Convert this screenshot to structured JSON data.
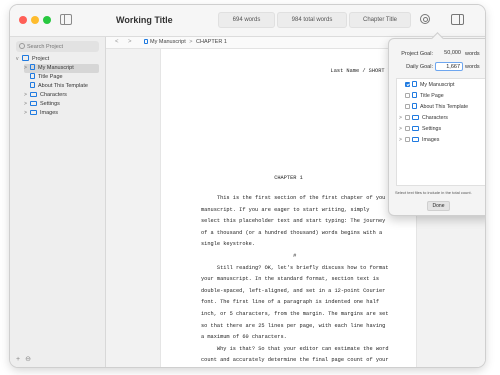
{
  "window": {
    "title": "Working Title",
    "words": "694 words",
    "total_words": "984 total words",
    "chapter": "Chapter Title"
  },
  "sidebar": {
    "search_placeholder": "Search Project",
    "project": "Project",
    "items": [
      {
        "label": "My Manuscript"
      },
      {
        "label": "Title Page"
      },
      {
        "label": "About This Template"
      },
      {
        "label": "Characters"
      },
      {
        "label": "Settings"
      },
      {
        "label": "Images"
      }
    ],
    "add": "+",
    "options": "⊖"
  },
  "pathbar": {
    "back": "<",
    "forward": ">",
    "crumb": "My Manuscript",
    "separator": ">",
    "section": "CHAPTER 1"
  },
  "document": {
    "running_head": "Last Name / SHORT TITLE /",
    "chapter_heading": "CHAPTER 1",
    "lines": [
      "     This is the first section of the first chapter of you",
      "manuscript. If you are eager to start writing, simply",
      "select this placeholder text and start typing: The journey",
      "of a thousand (or a hundred thousand) words begins with a",
      "single keystroke.",
      "                             #",
      "     Still reading? OK, let's briefly discuss how to format",
      "your manuscript. In the standard format, section text is",
      "double-spaced, left-aligned, and set in a 12-point Courier",
      "font. The first line of a paragraph is indented one half",
      "inch, or 5 characters, from the margin. The margins are set",
      "so that there are 25 lines per page, with each line having",
      "a maximum of 60 characters.",
      "     Why is that? So that your editor can estimate the word",
      "count and accurately determine the final page count of your"
    ]
  },
  "targets": {
    "project_goal_label": "Project Goal:",
    "project_goal_value": "50,000",
    "daily_goal_label": "Daily Goal:",
    "daily_goal_value": "1,667",
    "unit": "words",
    "list": [
      {
        "label": "My Manuscript",
        "checked": true
      },
      {
        "label": "Title Page",
        "checked": false
      },
      {
        "label": "About This Template",
        "checked": false
      },
      {
        "label": "Characters",
        "checked": false
      },
      {
        "label": "Settings",
        "checked": false
      },
      {
        "label": "Images",
        "checked": false
      }
    ],
    "help": "Select text files to include in the total count.",
    "done": "Done"
  },
  "colors": {
    "accent": "#1f7ae0",
    "close": "#ff5f57",
    "minimize": "#febc2e",
    "zoom": "#28c840"
  }
}
